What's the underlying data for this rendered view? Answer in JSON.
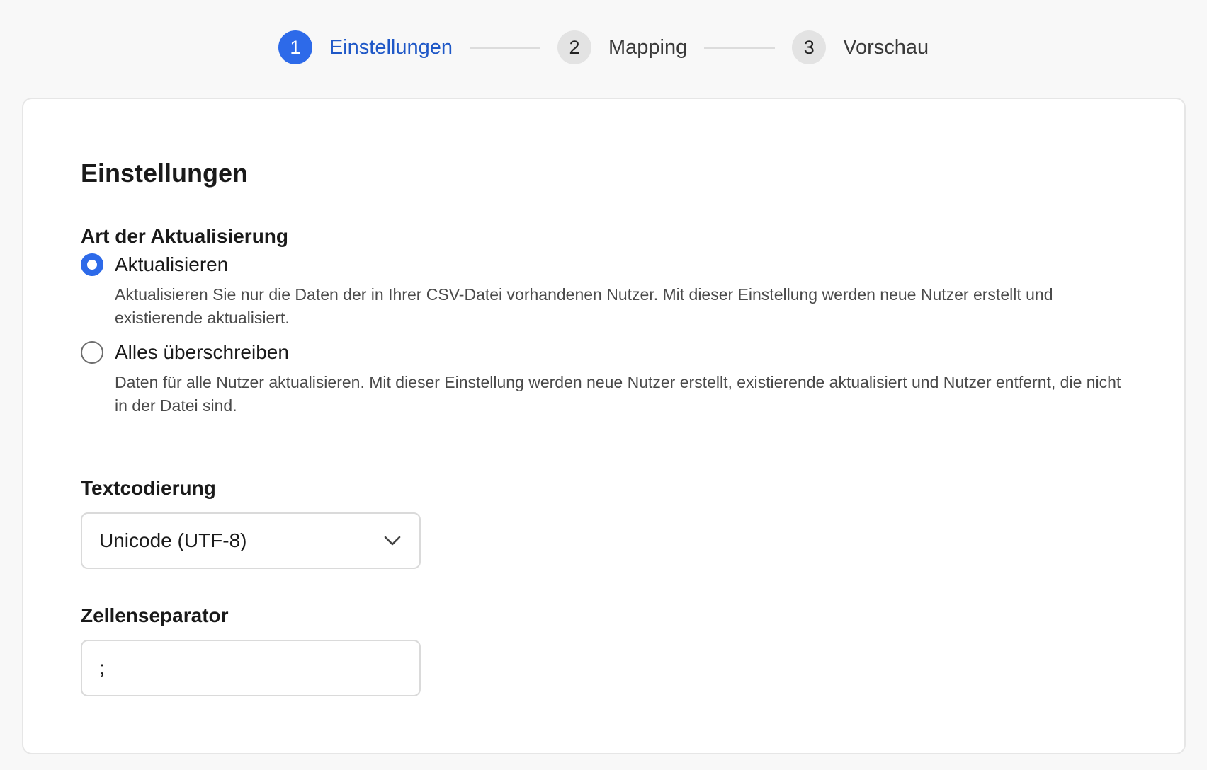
{
  "stepper": {
    "steps": [
      {
        "number": "1",
        "label": "Einstellungen",
        "active": true
      },
      {
        "number": "2",
        "label": "Mapping",
        "active": false
      },
      {
        "number": "3",
        "label": "Vorschau",
        "active": false
      }
    ]
  },
  "settings": {
    "title": "Einstellungen",
    "update_type": {
      "label": "Art der Aktualisierung",
      "options": [
        {
          "label": "Aktualisieren",
          "description": "Aktualisieren Sie nur die Daten der in Ihrer CSV-Datei vorhandenen Nutzer. Mit dieser Einstellung werden neue Nutzer erstellt und existierende aktualisiert.",
          "selected": true
        },
        {
          "label": "Alles überschreiben",
          "description": "Daten für alle Nutzer aktualisieren. Mit dieser Einstellung werden neue Nutzer erstellt, existierende aktualisiert und Nutzer entfernt, die nicht in der Datei sind.",
          "selected": false
        }
      ]
    },
    "encoding": {
      "label": "Textcodierung",
      "value": "Unicode (UTF-8)"
    },
    "separator": {
      "label": "Zellenseparator",
      "value": ";"
    }
  },
  "colors": {
    "accent": "#2d6ae9",
    "accent_text": "#1f58c7",
    "inactive_step": "#e3e3e3"
  },
  "icons": {
    "select_chevron": "chevron-down-icon"
  }
}
